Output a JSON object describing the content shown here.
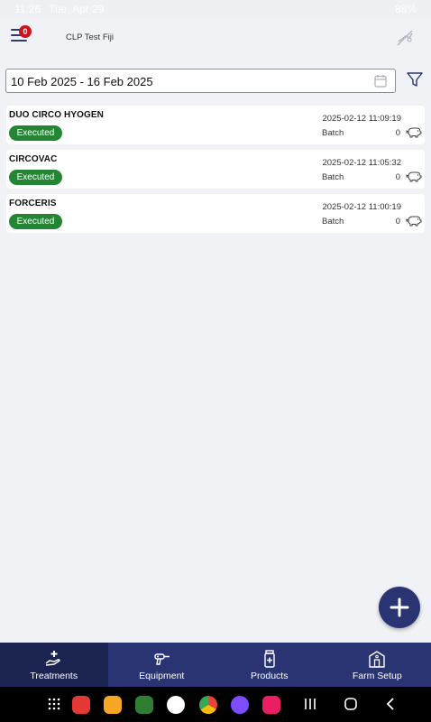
{
  "status_bar": {
    "time": "11:26",
    "date": "Tue, Apr 29",
    "battery": "88%"
  },
  "app_bar": {
    "title": "CLP Test Fiji",
    "notification_count": "0",
    "menu_icon": "hamburger-menu-icon",
    "sync_icon": "sync-off-icon"
  },
  "filter": {
    "date_range": "10 Feb 2025 - 16 Feb 2025",
    "calendar_icon": "calendar-icon",
    "filter_icon": "filter-icon"
  },
  "treatments": [
    {
      "name": "DUO CIRCO HYOGEN",
      "status": "Executed",
      "timestamp": "2025-02-12 11:09:19",
      "type": "Batch",
      "count": "0",
      "animal_icon": "pig-icon"
    },
    {
      "name": "CIRCOVAC",
      "status": "Executed",
      "timestamp": "2025-02-12 11:05:32",
      "type": "Batch",
      "count": "0",
      "animal_icon": "pig-icon"
    },
    {
      "name": "FORCERIS",
      "status": "Executed",
      "timestamp": "2025-02-12 11:00:19",
      "type": "Batch",
      "count": "0",
      "animal_icon": "pig-icon"
    }
  ],
  "fab": {
    "icon": "plus-icon"
  },
  "bottom_nav": [
    {
      "label": "Treatments",
      "icon": "treatment-hand-icon",
      "active": true
    },
    {
      "label": "Equipment",
      "icon": "injector-gun-icon",
      "active": false
    },
    {
      "label": "Products",
      "icon": "medicine-bottle-icon",
      "active": false
    },
    {
      "label": "Farm Setup",
      "icon": "barn-icon",
      "active": false
    }
  ],
  "colors": {
    "primary": "#2a3472",
    "primary_dark": "#1b2350",
    "executed": "#248535",
    "badge": "#d0121b",
    "background": "#f1f2f6"
  }
}
